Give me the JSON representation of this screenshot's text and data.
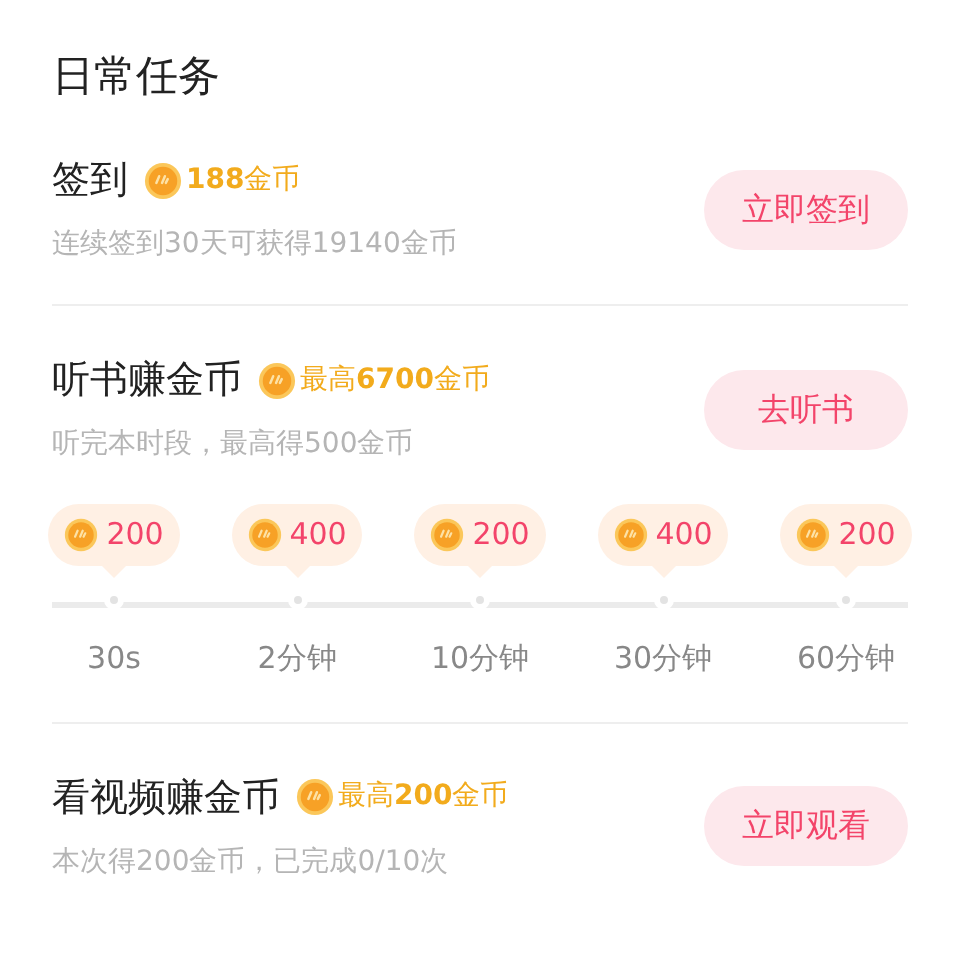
{
  "title": "日常任务",
  "tasks": [
    {
      "name": "签到",
      "reward": "**188**金币",
      "description": "连续签到30天可获得19140金币",
      "button": "立即签到"
    },
    {
      "name": "听书赚金币",
      "reward": "最高**6700**金币",
      "description": "听完本时段，最高得500金币",
      "button": "去听书",
      "milestones": [
        {
          "coins": "200",
          "time": "30s"
        },
        {
          "coins": "400",
          "time": "2分钟"
        },
        {
          "coins": "200",
          "time": "10分钟"
        },
        {
          "coins": "400",
          "time": "30分钟"
        },
        {
          "coins": "200",
          "time": "60分钟"
        }
      ]
    },
    {
      "name": "看视频赚金币",
      "reward": "最高**200**金币",
      "description": "本次得200金币，已完成0/10次",
      "button": "立即观看"
    }
  ]
}
